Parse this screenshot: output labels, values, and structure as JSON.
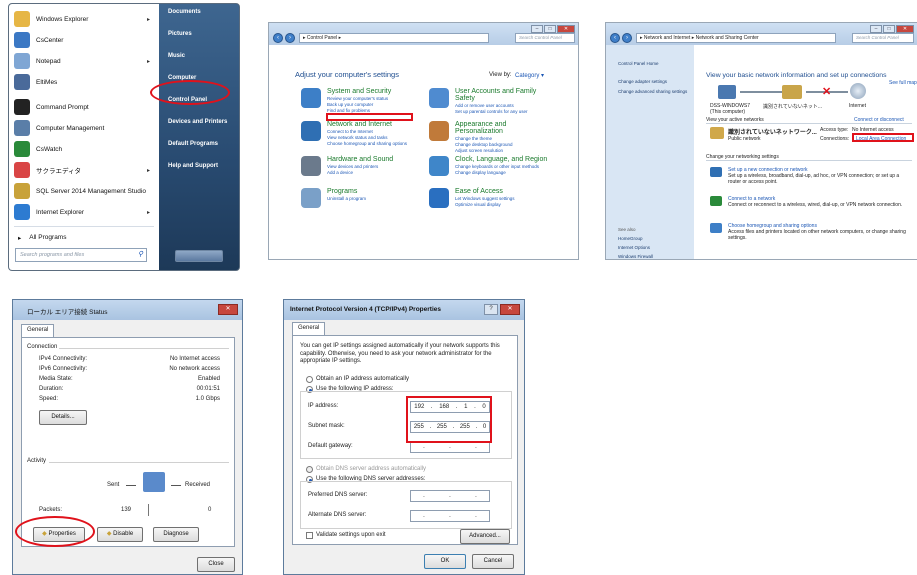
{
  "start_menu": {
    "programs": [
      {
        "label": "Windows Explorer",
        "has_arrow": true,
        "color": "#e6b645"
      },
      {
        "label": "CsCenter",
        "has_arrow": false,
        "color": "#3b78c4"
      },
      {
        "label": "Notepad",
        "has_arrow": true,
        "color": "#7fa6d4"
      },
      {
        "label": "EltiMes",
        "has_arrow": false,
        "color": "#4a6a9a"
      },
      {
        "label": "Command Prompt",
        "has_arrow": false,
        "color": "#222222"
      },
      {
        "label": "Computer Management",
        "has_arrow": false,
        "color": "#5a7ea8"
      },
      {
        "label": "CsWatch",
        "has_arrow": false,
        "color": "#2a8a3a"
      },
      {
        "label": "サクラエディタ",
        "has_arrow": true,
        "color": "#d94545"
      },
      {
        "label": "SQL Server 2014 Management Studio",
        "has_arrow": false,
        "color": "#c8a23a"
      },
      {
        "label": "Internet Explorer",
        "has_arrow": true,
        "color": "#2d7bd1"
      }
    ],
    "all_programs": "All Programs",
    "search_placeholder": "Search programs and files",
    "right_items": [
      "Documents",
      "Pictures",
      "Music",
      "Computer",
      "Control Panel",
      "Devices and Printers",
      "Default Programs",
      "Help and Support"
    ]
  },
  "control_panel": {
    "address": "▸ Control Panel ▸",
    "search": "Search Control Panel",
    "heading": "Adjust your computer's settings",
    "view_by_label": "View by:",
    "view_by_value": "Category ▾",
    "left_categories": [
      {
        "title": "System and Security",
        "links": [
          "Review your computer's status",
          "Back up your computer",
          "Find and fix problems"
        ],
        "color": "#3d7fc7"
      },
      {
        "title": "Network and Internet",
        "links": [
          "Connect to the Internet",
          "View network status and tasks",
          "Choose homegroup and sharing options"
        ],
        "color": "#2f6fb3"
      },
      {
        "title": "Hardware and Sound",
        "links": [
          "View devices and printers",
          "Add a device"
        ],
        "color": "#6b7a8c"
      },
      {
        "title": "Programs",
        "links": [
          "Uninstall a program"
        ],
        "color": "#7aa0c8"
      }
    ],
    "right_categories": [
      {
        "title": "User Accounts and Family Safety",
        "links": [
          "Add or remove user accounts",
          "Set up parental controls for any user"
        ],
        "color": "#4f8bd0"
      },
      {
        "title": "Appearance and Personalization",
        "links": [
          "Change the theme",
          "Change desktop background",
          "Adjust screen resolution"
        ],
        "color": "#c07a3a"
      },
      {
        "title": "Clock, Language, and Region",
        "links": [
          "Change keyboards or other input methods",
          "Change display language"
        ],
        "color": "#3f86c9"
      },
      {
        "title": "Ease of Access",
        "links": [
          "Let Windows suggest settings",
          "Optimize visual display"
        ],
        "color": "#2a6fc0"
      }
    ]
  },
  "network_center": {
    "address": "▸ Network and Internet ▸ Network and Sharing Center",
    "search": "Search Control Panel",
    "side_links": [
      "Control Panel Home",
      "Change adapter settings",
      "Change advanced sharing settings"
    ],
    "see_also": "See also",
    "see_also_links": [
      "HomeGroup",
      "Internet Options",
      "Windows Firewall"
    ],
    "heading": "View your basic network information and set up connections",
    "see_full_map": "See full map",
    "map_labels": [
      "DSS-WINDOWS7",
      "識別されていないネット...",
      "Internet"
    ],
    "this_computer": "(This computer)",
    "active_networks": "View your active networks",
    "connect_disconnect": "Connect or disconnect",
    "network_name": "識別されていないネットワーク...",
    "network_type": "Public network",
    "access_type_label": "Access type:",
    "access_type_value": "No Internet access",
    "connections_label": "Connections:",
    "connections_value": "Local Area Connection",
    "change_settings": "Change your networking settings",
    "tasks": [
      {
        "title": "Set up a new connection or network",
        "desc": "Set up a wireless, broadband, dial-up, ad hoc, or VPN connection; or set up a router or access point."
      },
      {
        "title": "Connect to a network",
        "desc": "Connect or reconnect to a wireless, wired, dial-up, or VPN network connection."
      },
      {
        "title": "Choose homegroup and sharing options",
        "desc": "Access files and printers located on other network computers, or change sharing settings."
      }
    ]
  },
  "status_dialog": {
    "title": "ローカル エリア接続 Status",
    "tab": "General",
    "connection_label": "Connection",
    "rows": [
      {
        "label": "IPv4 Connectivity:",
        "value": "No Internet access"
      },
      {
        "label": "IPv6 Connectivity:",
        "value": "No network access"
      },
      {
        "label": "Media State:",
        "value": "Enabled"
      },
      {
        "label": "Duration:",
        "value": "00:01:51"
      },
      {
        "label": "Speed:",
        "value": "1.0 Gbps"
      }
    ],
    "details_btn": "Details...",
    "activity_label": "Activity",
    "sent_label": "Sent",
    "received_label": "Received",
    "packets_label": "Packets:",
    "packets_sent": "139",
    "packets_received": "0",
    "properties_btn": "Properties",
    "disable_btn": "Disable",
    "diagnose_btn": "Diagnose",
    "close_btn": "Close"
  },
  "ipv4_dialog": {
    "title": "Internet Protocol Version 4 (TCP/IPv4) Properties",
    "tab": "General",
    "intro": "You can get IP settings assigned automatically if your network supports this capability. Otherwise, you need to ask your network administrator for the appropriate IP settings.",
    "obtain_auto": "Obtain an IP address automatically",
    "use_following": "Use the following IP address:",
    "ip_label": "IP address:",
    "ip_value": [
      "192",
      "168",
      "1",
      "0"
    ],
    "subnet_label": "Subnet mask:",
    "subnet_value": [
      "255",
      "255",
      "255",
      "0"
    ],
    "gateway_label": "Default gateway:",
    "dns_auto": "Obtain DNS server address automatically",
    "dns_use": "Use the following DNS server addresses:",
    "preferred_dns": "Preferred DNS server:",
    "alternate_dns": "Alternate DNS server:",
    "validate": "Validate settings upon exit",
    "advanced_btn": "Advanced...",
    "ok_btn": "OK",
    "cancel_btn": "Cancel"
  },
  "colors": {
    "highlight": "#e0121b",
    "link": "#1c57b5",
    "category_green": "#1a7a2c"
  }
}
